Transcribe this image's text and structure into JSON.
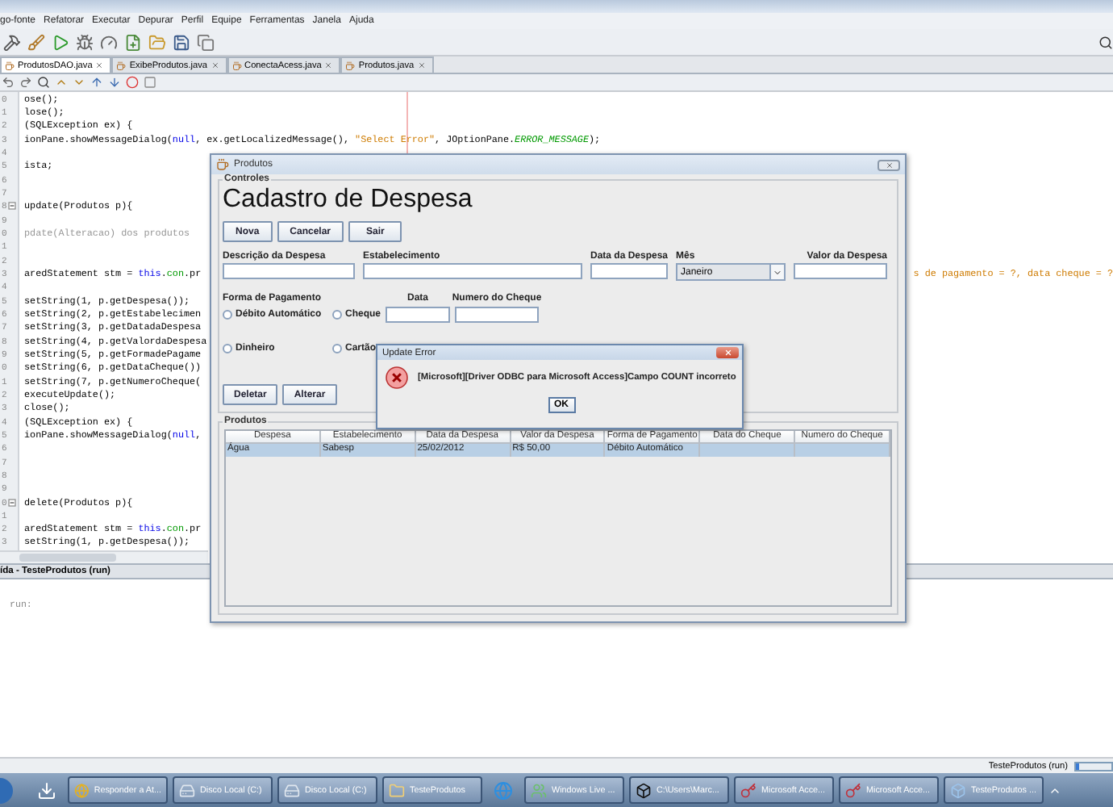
{
  "menu": [
    "go-fonte",
    "Refatorar",
    "Executar",
    "Depurar",
    "Perfil",
    "Equipe",
    "Ferramentas",
    "Janela",
    "Ajuda"
  ],
  "editor_tabs": [
    {
      "label": "ProdutosDAO.java",
      "selected": true
    },
    {
      "label": "ExibeProdutos.java",
      "selected": false
    },
    {
      "label": "ConectaAcess.java",
      "selected": false
    },
    {
      "label": "Produtos.java",
      "selected": false
    }
  ],
  "code_lines": [
    {
      "num": "0",
      "segments": [
        {
          "kind": "code",
          "text": "ose();"
        }
      ]
    },
    {
      "num": "1",
      "segments": [
        {
          "kind": "code",
          "text": "lose();"
        }
      ]
    },
    {
      "num": "2",
      "segments": [
        {
          "kind": "code",
          "text": "(SQLException ex) {"
        }
      ]
    },
    {
      "num": "3",
      "segments": [
        {
          "kind": "code",
          "text": "ionPane.showMessageDialog("
        },
        {
          "kind": "literal",
          "text": "null"
        },
        {
          "kind": "code",
          "text": ", ex.getLocalizedMessage(), "
        },
        {
          "kind": "string",
          "text": "\"Select Error\""
        },
        {
          "kind": "code",
          "text": ", JOptionPane."
        },
        {
          "kind": "constant",
          "text": "ERROR_MESSAGE"
        },
        {
          "kind": "code",
          "text": ");"
        }
      ]
    },
    {
      "num": "4"
    },
    {
      "num": "5",
      "segments": [
        {
          "kind": "code",
          "text": "ista;"
        }
      ]
    },
    {
      "num": "6"
    },
    {
      "num": "7"
    },
    {
      "num": "8",
      "fold": true,
      "segments": [
        {
          "kind": "code",
          "text": "update(Produtos p){"
        }
      ]
    },
    {
      "num": "9"
    },
    {
      "num": "0",
      "segments": [
        {
          "kind": "comment",
          "text": "pdate(Alteracao) dos produtos"
        }
      ]
    },
    {
      "num": "1"
    },
    {
      "num": "2"
    },
    {
      "num": "3",
      "segments": [
        {
          "kind": "code",
          "text": "aredStatement stm = "
        },
        {
          "kind": "literal",
          "text": "this"
        },
        {
          "kind": "code",
          "text": "."
        },
        {
          "kind": "field",
          "text": "con"
        },
        {
          "kind": "code",
          "text": ".pr"
        }
      ],
      "tail": "s de pagamento = ?, data cheque = ?"
    },
    {
      "num": "4"
    },
    {
      "num": "5",
      "segments": [
        {
          "kind": "code",
          "text": "setString(1, p.getDespesa());"
        }
      ]
    },
    {
      "num": "6",
      "segments": [
        {
          "kind": "code",
          "text": "setString(2, p.getEstabelecimen"
        }
      ]
    },
    {
      "num": "7",
      "segments": [
        {
          "kind": "code",
          "text": "setString(3, p.getDatadaDespesa"
        }
      ]
    },
    {
      "num": "8",
      "segments": [
        {
          "kind": "code",
          "text": "setString(4, p.getValordaDespesa"
        }
      ]
    },
    {
      "num": "9",
      "segments": [
        {
          "kind": "code",
          "text": "setString(5, p.getFormadePagame"
        }
      ]
    },
    {
      "num": "0",
      "segments": [
        {
          "kind": "code",
          "text": "setString(6, p.getDataCheque())"
        }
      ]
    },
    {
      "num": "1",
      "segments": [
        {
          "kind": "code",
          "text": "setString(7, p.getNumeroCheque("
        }
      ]
    },
    {
      "num": "2",
      "segments": [
        {
          "kind": "code",
          "text": "executeUpdate();"
        }
      ]
    },
    {
      "num": "3",
      "segments": [
        {
          "kind": "code",
          "text": "close();"
        }
      ]
    },
    {
      "num": "4",
      "segments": [
        {
          "kind": "code",
          "text": "(SQLException ex) {"
        }
      ]
    },
    {
      "num": "5",
      "segments": [
        {
          "kind": "code",
          "text": "ionPane.showMessageDialog("
        },
        {
          "kind": "literal",
          "text": "null"
        },
        {
          "kind": "code",
          "text": ","
        }
      ]
    },
    {
      "num": "6"
    },
    {
      "num": "7"
    },
    {
      "num": "8"
    },
    {
      "num": "9"
    },
    {
      "num": "0",
      "fold": true,
      "segments": [
        {
          "kind": "code",
          "text": "delete(Produtos p){"
        }
      ]
    },
    {
      "num": "1"
    },
    {
      "num": "2",
      "segments": [
        {
          "kind": "code",
          "text": "aredStatement stm = "
        },
        {
          "kind": "literal",
          "text": "this"
        },
        {
          "kind": "code",
          "text": "."
        },
        {
          "kind": "field",
          "text": "con"
        },
        {
          "kind": "code",
          "text": ".pr"
        }
      ]
    },
    {
      "num": "3",
      "segments": [
        {
          "kind": "code",
          "text": "setString(1, p.getDespesa());"
        }
      ]
    }
  ],
  "output": {
    "tab": "ída - TesteProdutos (run)",
    "text": "run:"
  },
  "status_bar": {
    "task": "TesteProdutos (run)",
    "level": 0.1
  },
  "taskbar": [
    {
      "kind": "download"
    },
    {
      "kind": "browser",
      "label": "Responder a At..."
    },
    {
      "kind": "drive",
      "label": "Disco Local (C:)"
    },
    {
      "kind": "drive",
      "label": "Disco Local (C:)"
    },
    {
      "kind": "folder",
      "label": "TesteProdutos"
    },
    {
      "kind": "ie"
    },
    {
      "kind": "messenger",
      "label": "Windows Live ..."
    },
    {
      "kind": "archive",
      "label": "C:\\Users\\Marc..."
    },
    {
      "kind": "database",
      "label": "Microsoft Acce..."
    },
    {
      "kind": "database",
      "label": "Microsoft Acce..."
    },
    {
      "kind": "java",
      "label": "TesteProdutos ..."
    }
  ],
  "produtos_window": {
    "title": "Produtos",
    "controls_group": "Controles",
    "heading": "Cadastro de Despesa",
    "top_buttons": [
      "Nova",
      "Cancelar",
      "Sair"
    ],
    "fields": [
      {
        "kind": "text",
        "label": "Descrição da Despesa"
      },
      {
        "kind": "text",
        "label": "Estabelecimento"
      },
      {
        "kind": "text",
        "label": "Data da Despesa"
      },
      {
        "kind": "select",
        "label": "Mês",
        "value": "Janeiro"
      },
      {
        "kind": "text",
        "label": "Valor da Despesa"
      }
    ],
    "payment": {
      "label": "Forma de Pagamento",
      "date_label": "Data",
      "cheque_label": "Numero do Cheque",
      "options": [
        {
          "label": "Débito Automático",
          "selected": false
        },
        {
          "label": "Cheque",
          "selected": false
        },
        {
          "label": "Dinheiro",
          "selected": false
        },
        {
          "label": "Cartão",
          "selected": false
        }
      ]
    },
    "bottom_buttons": [
      "Deletar",
      "Alterar"
    ],
    "table_group": "Produtos",
    "table": {
      "columns": [
        "Despesa",
        "Estabelecimento",
        "Data da Despesa",
        "Valor da Despesa",
        "Forma de Pagamento",
        "Data do Cheque",
        "Numero do Cheque"
      ],
      "rows": [
        {
          "selected": true,
          "cells": [
            "Água",
            "Sabesp",
            "25/02/2012",
            "R$ 50,00",
            "Débito Automático"
          ]
        }
      ]
    }
  },
  "error_dialog": {
    "title": "Update Error",
    "message": "[Microsoft][Driver ODBC para Microsoft Access]Campo COUNT incorreto",
    "button": "OK"
  }
}
